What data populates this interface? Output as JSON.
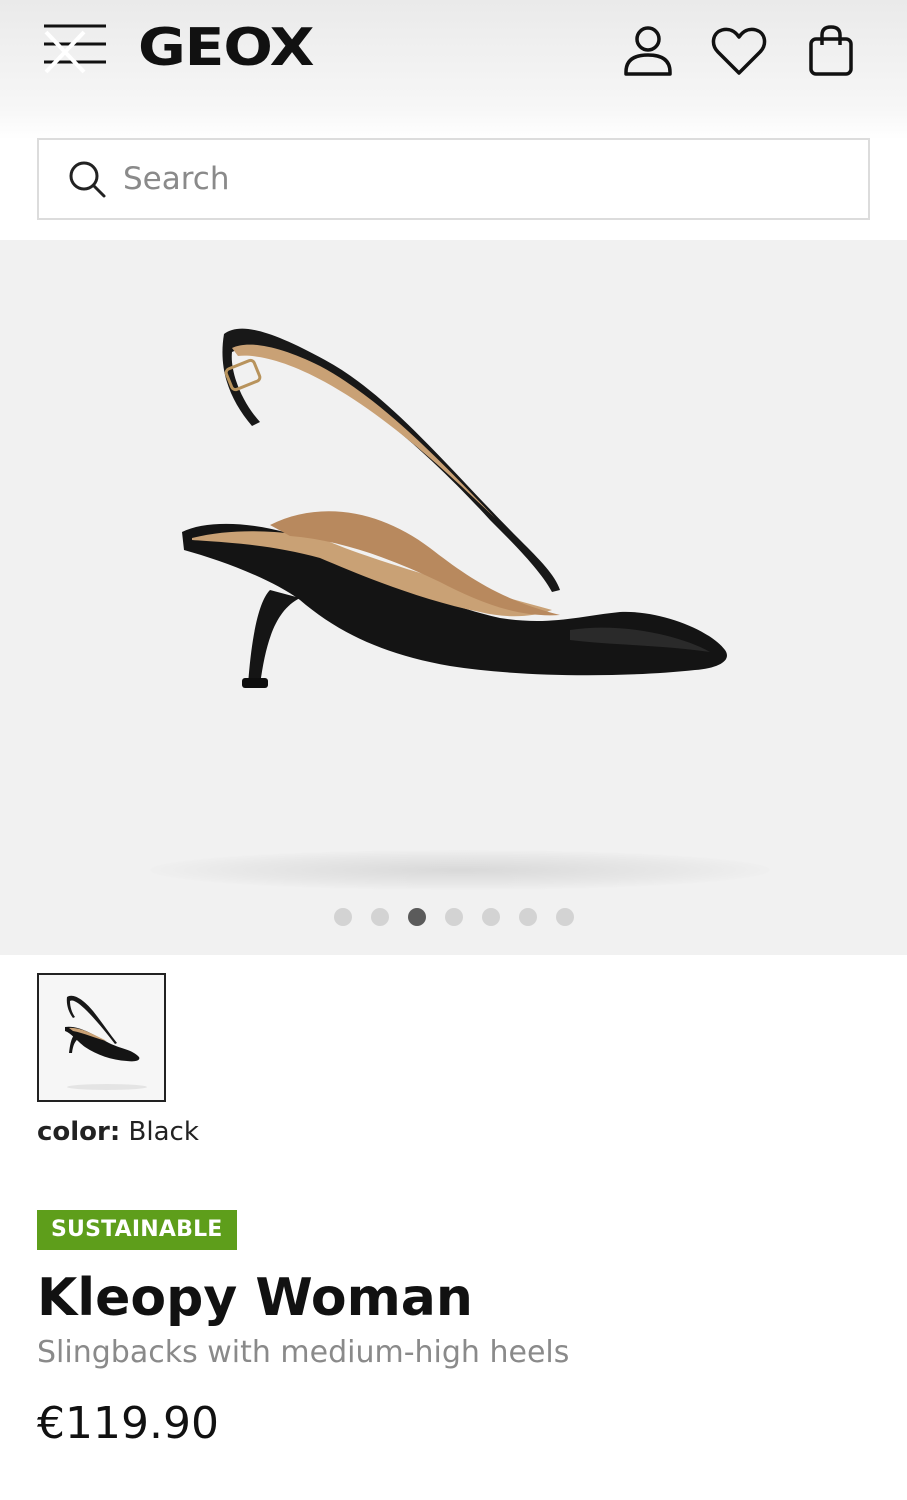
{
  "header": {
    "brand": "GEOX",
    "icons": [
      "menu-icon",
      "account-icon",
      "wishlist-heart-icon",
      "shopping-bag-icon"
    ]
  },
  "search": {
    "placeholder": "Search"
  },
  "gallery": {
    "image_count": 7,
    "active_index": 2,
    "background_color": "#f1f1f1"
  },
  "product": {
    "color_label": "color:",
    "color_value": "Black",
    "badge": "SUSTAINABLE",
    "badge_color": "#5e9e1b",
    "name": "Kleopy Woman",
    "description": "Slingbacks with medium-high heels",
    "price": "€119.90"
  }
}
